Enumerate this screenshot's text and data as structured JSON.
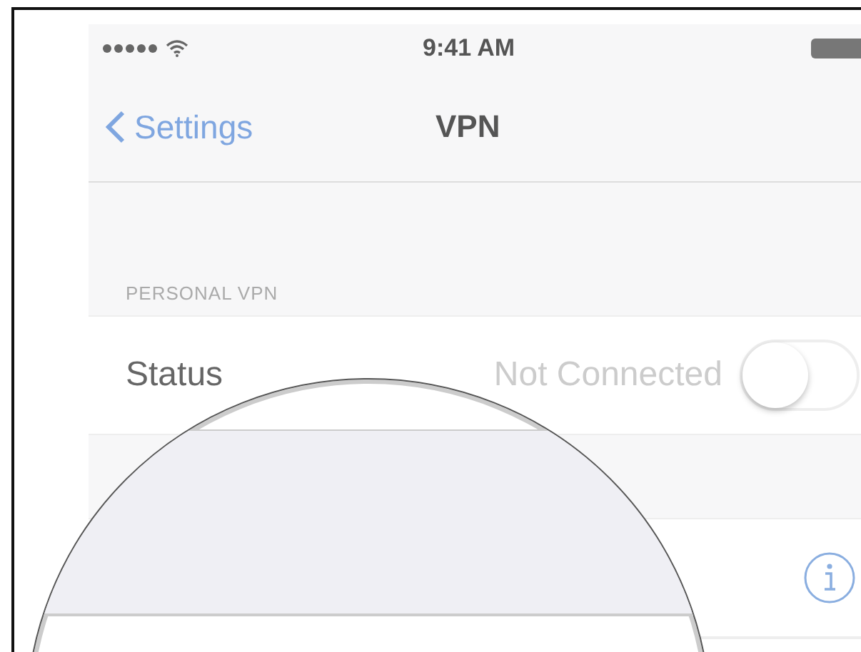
{
  "status_bar": {
    "time": "9:41 AM"
  },
  "nav_bar": {
    "back": "Settings",
    "title": "VPN"
  },
  "section": {
    "header": "PERSONAL VPN",
    "rows": [
      {
        "kind": "toggle",
        "label": "Status",
        "value": "Not Connected",
        "on": false
      }
    ]
  },
  "configurations": [
    {
      "kind": "info"
    }
  ]
}
